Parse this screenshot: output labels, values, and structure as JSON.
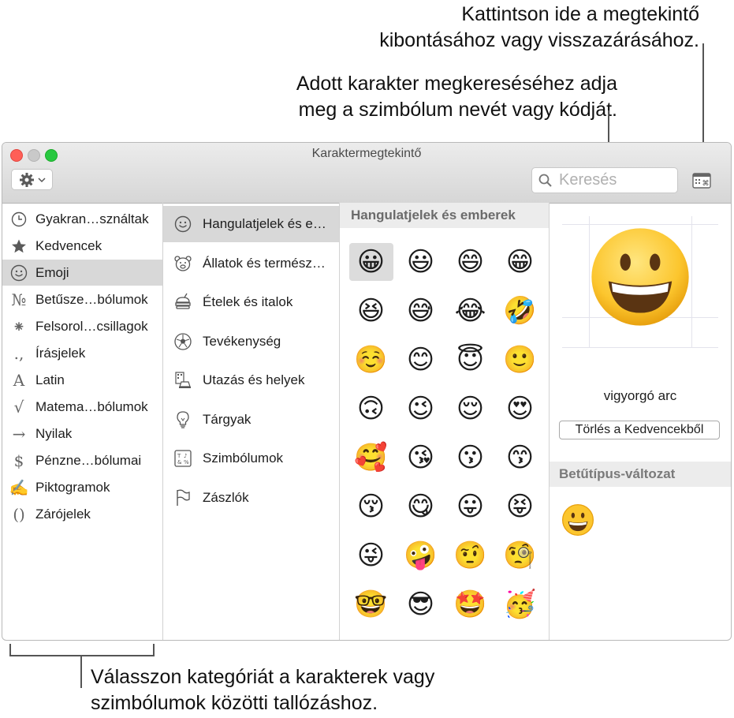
{
  "callouts": {
    "viewer_toggle": [
      "Kattintson ide a megtekintő",
      "kibontásához vagy visszazárásához."
    ],
    "search": [
      "Adott karakter megkereséséhez adja",
      "meg a szimbólum nevét vagy kódját."
    ],
    "categories": [
      "Válasszon kategóriát a karakterek vagy",
      "szimbólumok közötti tallózáshoz."
    ]
  },
  "window": {
    "title": "Karaktermegtekintő"
  },
  "search": {
    "placeholder": "Keresés"
  },
  "categories": [
    {
      "label": "Gyakran…sználtak",
      "icon": "clock-icon"
    },
    {
      "label": "Kedvencek",
      "icon": "star-icon"
    },
    {
      "label": "Emoji",
      "icon": "smiley-icon",
      "selected": true
    },
    {
      "label": "Betűsze…bólumok",
      "icon": "numero-icon",
      "glyph": "№"
    },
    {
      "label": "Felsorol…csillagok",
      "icon": "asterisk-icon",
      "glyph": "⁕"
    },
    {
      "label": "Írásjelek",
      "icon": "punctuation-icon",
      "glyph": ".,"
    },
    {
      "label": "Latin",
      "icon": "latin-a-icon",
      "glyph": "A"
    },
    {
      "label": "Matema…bólumok",
      "icon": "square-root-icon",
      "glyph": "√"
    },
    {
      "label": "Nyilak",
      "icon": "arrow-icon",
      "glyph": "→"
    },
    {
      "label": "Pénzne…bólumai",
      "icon": "dollar-icon",
      "glyph": "$"
    },
    {
      "label": "Piktogramok",
      "icon": "pencil-icon",
      "glyph": "✍"
    },
    {
      "label": "Zárójelek",
      "icon": "parentheses-icon",
      "glyph": "()"
    }
  ],
  "subcategories": [
    {
      "label": "Hangulatjelek és e…",
      "icon": "smiley-icon",
      "selected": true
    },
    {
      "label": "Állatok és termész…",
      "icon": "bear-icon"
    },
    {
      "label": "Ételek és italok",
      "icon": "burger-icon"
    },
    {
      "label": "Tevékenység",
      "icon": "soccer-ball-icon"
    },
    {
      "label": "Utazás és helyek",
      "icon": "car-building-icon"
    },
    {
      "label": "Tárgyak",
      "icon": "lightbulb-icon"
    },
    {
      "label": "Szimbólumok",
      "icon": "symbols-icon"
    },
    {
      "label": "Zászlók",
      "icon": "flag-icon"
    }
  ],
  "grid": {
    "header": "Hangulatjelek és emberek",
    "emojis": [
      "😀",
      "😃",
      "😄",
      "😁",
      "😆",
      "😅",
      "😂",
      "🤣",
      "☺️",
      "😊",
      "😇",
      "🙂",
      "🙃",
      "😉",
      "😌",
      "😍",
      "🥰",
      "😘",
      "😗",
      "😙",
      "😚",
      "😋",
      "😛",
      "😝",
      "😜",
      "🤪",
      "🤨",
      "🧐",
      "🤓",
      "😎",
      "🤩",
      "🥳",
      "😏",
      "😒",
      "😞",
      "😔"
    ]
  },
  "detail": {
    "name": "vigyorgó arc",
    "favorite_button": "Törlés a Kedvencekből",
    "variants_header": "Betűtípus-változat"
  }
}
